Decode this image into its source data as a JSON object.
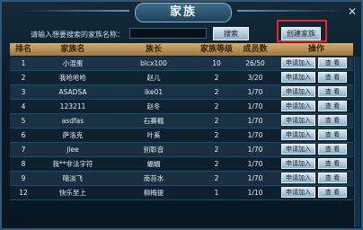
{
  "title": "家族",
  "close_glyph": "✕",
  "search": {
    "label": "请输入想要搜索的家族名称：",
    "value": "",
    "button": "搜索",
    "create_button": "创建家族"
  },
  "table": {
    "headers": [
      "排名",
      "家族名",
      "族长",
      "家族等级",
      "成员数",
      "操作"
    ],
    "rows": [
      {
        "rank": "1",
        "name": "小混蛋",
        "leader": "blcx100",
        "level": "10",
        "count": "26/50",
        "apply": "申请加入",
        "view": "查 看"
      },
      {
        "rank": "2",
        "name": "我呛呛呛",
        "leader": "赵儿",
        "level": "2",
        "count": "3/20",
        "apply": "申请加入",
        "view": "查 看"
      },
      {
        "rank": "3",
        "name": "ASADSA",
        "leader": "ike01",
        "level": "2",
        "count": "1/70",
        "apply": "申请加入",
        "view": "查 看"
      },
      {
        "rank": "4",
        "name": "123211",
        "leader": "赵冬",
        "level": "2",
        "count": "1/70",
        "apply": "申请加入",
        "view": "查 看"
      },
      {
        "rank": "5",
        "name": "asdfas",
        "leader": "石赛楓",
        "level": "2",
        "count": "1/70",
        "apply": "申请加入",
        "view": "查 看"
      },
      {
        "rank": "6",
        "name": "萨洛克",
        "leader": "叶奚",
        "level": "2",
        "count": "1/70",
        "apply": "申请加入",
        "view": "查 看"
      },
      {
        "rank": "7",
        "name": "jlee",
        "leader": "别彰音",
        "level": "2",
        "count": "1/70",
        "apply": "申请加入",
        "view": "查 看"
      },
      {
        "rank": "8",
        "name": "我**非法字符",
        "leader": "蝠蝠",
        "level": "2",
        "count": "1/70",
        "apply": "申请加入",
        "view": "查 看"
      },
      {
        "rank": "9",
        "name": "嘻淡飞",
        "leader": "南苔水",
        "level": "2",
        "count": "1/70",
        "apply": "申请加入",
        "view": "查 看"
      },
      {
        "rank": "12",
        "name": "快乐至上",
        "leader": "柳梅提",
        "level": "1",
        "count": "1/10",
        "apply": "申请加入",
        "view": "查 看"
      }
    ]
  },
  "colors": {
    "highlight": "#e0282b",
    "header": "#c9a266"
  }
}
